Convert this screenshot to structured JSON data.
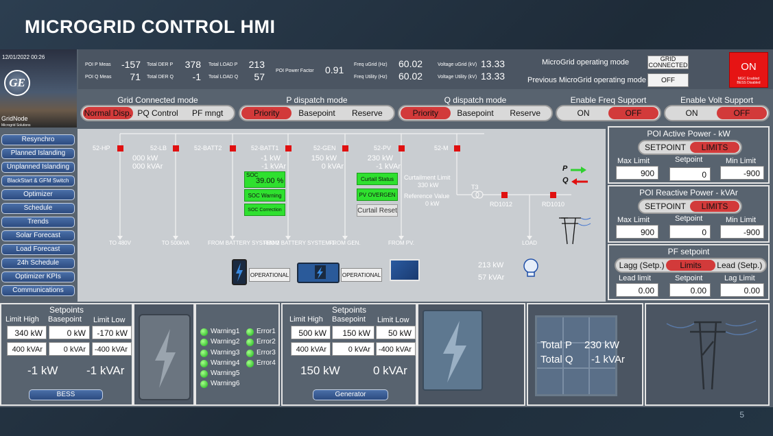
{
  "slide": {
    "title": "MICROGRID CONTROL HMI",
    "page": "5"
  },
  "header": {
    "datetime": "12/01/2022 00:26",
    "logo_text": "GE",
    "gridnode": "GridNode",
    "gridnode_sub": "Microgrid Solutions",
    "poi_p_label": "POI P Meas",
    "poi_p": "-157",
    "poi_q_label": "POI Q Meas",
    "poi_q": "71",
    "der_p_label": "Total DER P",
    "der_p": "378",
    "der_q_label": "Total DER Q",
    "der_q": "-1",
    "load_p_label": "Total LOAD P",
    "load_p": "213",
    "load_q_label": "Total LOAD Q",
    "load_q": "57",
    "pf_label": "POI Power Factor",
    "pf": "0.91",
    "freq_ugrid_label": "Freq uGrid (Hz)",
    "freq_ugrid": "60.02",
    "freq_utility_label": "Freq Utility (Hz)",
    "freq_utility": "60.02",
    "volt_ugrid_label": "Voltage uGrid (kV)",
    "volt_ugrid": "13.33",
    "volt_utility_label": "Voltage Utility (kV)",
    "volt_utility": "13.33",
    "mode_label": "MicroGrid operating mode",
    "mode_value": "GRID CONNECTED",
    "prev_mode_label": "Previous MicroGrid operating mode",
    "prev_mode_value": "OFF",
    "on_label": "ON",
    "on_sub": "MGC Enabled BESS Disabled"
  },
  "modes": {
    "grid_connected": {
      "title": "Grid Connected mode",
      "options": [
        "Normal Disp.",
        "PQ Control",
        "PF mngt"
      ],
      "active": 0
    },
    "p_dispatch": {
      "title": "P dispatch mode",
      "options": [
        "Priority",
        "Basepoint",
        "Reserve"
      ],
      "active": 0
    },
    "q_dispatch": {
      "title": "Q dispatch mode",
      "options": [
        "Priority",
        "Basepoint",
        "Reserve"
      ],
      "active": 0
    },
    "freq_support": {
      "title": "Enable Freq Support",
      "options": [
        "ON",
        "OFF"
      ],
      "active": 1
    },
    "volt_support": {
      "title": "Enable Volt Support",
      "options": [
        "ON",
        "OFF"
      ],
      "active": 1
    }
  },
  "sidebar": {
    "items": [
      "Resynchro",
      "Planned Islanding",
      "Unplanned Islanding",
      "BlackStart & GFM Switch",
      "Optimizer",
      "Schedule",
      "Trends",
      "Solar Forecast",
      "Load Forecast",
      "24h Schedule",
      "Optimizer KPIs",
      "Communications"
    ]
  },
  "diagram": {
    "breakers": [
      "52-HP",
      "52-LB",
      "52-BATT2",
      "52-BATT1",
      "52-GEN",
      "52-PV",
      "52-M"
    ],
    "lb_p": "000 kW",
    "lb_q": "000 kVAr",
    "batt1_p": "-1 kW",
    "batt1_q": "-1 kVAr",
    "gen_p": "150 kW",
    "gen_q": "0 kVAr",
    "pv_p": "230 kW",
    "pv_q": "-1 kVAr",
    "soc_label": "SOC",
    "soc_value": "39.00 %",
    "soc_warning": "SOC Warning",
    "soc_correction": "SOC Correction",
    "curtail_status": "Curtail Status",
    "pv_overgen": "PV OVERGEN",
    "curtail_reset": "Curtail Reset",
    "curtail_limit_label": "Curtailment Limit",
    "curtail_limit": "330 kW",
    "ref_label": "Reference Value",
    "ref_value": "0 kW",
    "p_label": "P",
    "q_label": "Q",
    "t3": "T3",
    "rd1012": "RD1012",
    "rd1010": "RD1010",
    "sinks": [
      "TO 480V",
      "TO 500kVA",
      "FROM BATTERY SYSTEM-2",
      "FROM BATTERY SYSTEM-1",
      "FROM GEN.",
      "FROM PV.",
      "LOAD"
    ],
    "op1": "OPERATIONAL",
    "op2": "OPERATIONAL",
    "load_p": "213 kW",
    "load_q": "57 kVAr"
  },
  "poi_active": {
    "title": "POI Active Power - kW",
    "tabs": [
      "SETPOINT",
      "LIMITS"
    ],
    "active": 1,
    "max_label": "Max Limit",
    "max": "900",
    "set_label": "Setpoint",
    "set": "0",
    "min_label": "Min Limit",
    "min": "-900"
  },
  "poi_reactive": {
    "title": "POI Reactive Power - kVAr",
    "tabs": [
      "SETPOINT",
      "LIMITS"
    ],
    "active": 1,
    "max_label": "Max Limit",
    "max": "900",
    "set_label": "Setpoint",
    "set": "0",
    "min_label": "Min Limit",
    "min": "-900"
  },
  "pf_setpoint": {
    "title": "PF setpoint",
    "tabs": [
      "Lagg (Setp.)",
      "Limits",
      "Lead (Setp.)"
    ],
    "active": 1,
    "lead_label": "Lead limit",
    "lead": "0.00",
    "set_label": "Setpoint",
    "set": "0.00",
    "lag_label": "Lag Limit",
    "lag": "0.00"
  },
  "bess": {
    "title": "Setpoints",
    "col1": "Limit High",
    "col2": "Basepoint",
    "col3": "Limit Low",
    "r1": [
      "340 kW",
      "0 kW",
      "-170 kW"
    ],
    "r2": [
      "400 kVAr",
      "0 kVAr",
      "-400 kVAr"
    ],
    "p": "-1 kW",
    "q": "-1 kVAr",
    "button": "BESS",
    "warnings": [
      "Warning1",
      "Warning2",
      "Warning3",
      "Warning4",
      "Warning5",
      "Warning6"
    ],
    "errors": [
      "Error1",
      "Error2",
      "Error3",
      "Error4"
    ]
  },
  "gen": {
    "title": "Setpoints",
    "col1": "Limit High",
    "col2": "Basepoint",
    "col3": "Limit Low",
    "r1": [
      "500 kW",
      "150 kW",
      "50 kW"
    ],
    "r2": [
      "400 kVAr",
      "0 kVAr",
      "-400 kVAr"
    ],
    "p": "150 kW",
    "q": "0 kVAr",
    "button": "Generator"
  },
  "pv": {
    "total_p_label": "Total P",
    "total_p": "230 kW",
    "total_q_label": "Total Q",
    "total_q": "-1 kVAr"
  },
  "colors": {
    "active": "#d23a3a",
    "alarm": "#e61414",
    "ok": "#2fe02f",
    "bg": "#58636f"
  }
}
